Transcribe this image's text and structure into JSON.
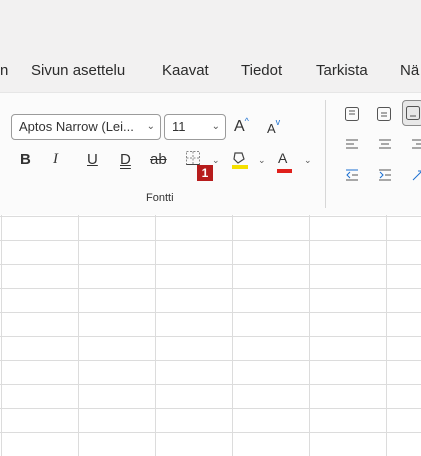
{
  "tabs": [
    {
      "label": "n"
    },
    {
      "label": "Sivun asettelu"
    },
    {
      "label": "Kaavat"
    },
    {
      "label": "Tiedot"
    },
    {
      "label": "Tarkista"
    },
    {
      "label": "Nä"
    }
  ],
  "font": {
    "name_value": "Aptos Narrow (Lei...",
    "size_value": "11",
    "increase_label": "A",
    "decrease_label": "A",
    "bold_label": "B",
    "italic_label": "I",
    "underline_label": "U",
    "double_underline_label": "D",
    "strike_label": "ab",
    "font_color_label": "A",
    "group_label": "Fontti",
    "fill_color": "#f5e000",
    "text_color": "#e0201b"
  },
  "badge": {
    "label": "1"
  },
  "colors": {
    "badge": "#b71c1c",
    "ribbon": "#fbfbfb",
    "chrome": "#f2f1f1"
  }
}
